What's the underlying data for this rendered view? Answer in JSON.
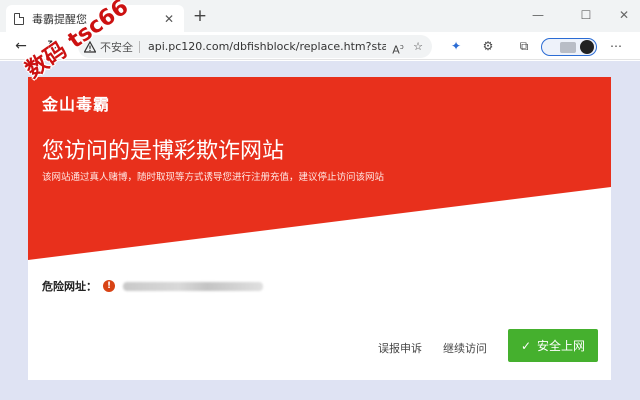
{
  "browser": {
    "tab": {
      "title": "毒霸提醒您",
      "close_glyph": "✕"
    },
    "new_tab_glyph": "+",
    "window_controls": {
      "minimize": "—",
      "maximize": "☐",
      "close": "✕"
    },
    "nav": {
      "back": "←",
      "refresh": "↻"
    },
    "address": {
      "security_label": "不安全",
      "url": "api.pc120.com/dbfishblock/replace.htm?stat..."
    }
  },
  "page": {
    "brand": "金山毒霸",
    "headline": "您访问的是博彩欺诈网站",
    "subtext": "该网站通过真人赌博，随时取现等方式诱导您进行注册充值，建议停止访问该网站",
    "danger_label": "危险网址：",
    "danger_icon_glyph": "!",
    "actions": {
      "report": "误报申诉",
      "continue": "继续访问",
      "safe": "安全上网"
    },
    "colors": {
      "banner_red": "#e8301c",
      "safe_green": "#45b02e",
      "page_bg": "#dfe3f3"
    }
  },
  "watermark": "数码 tsc66"
}
